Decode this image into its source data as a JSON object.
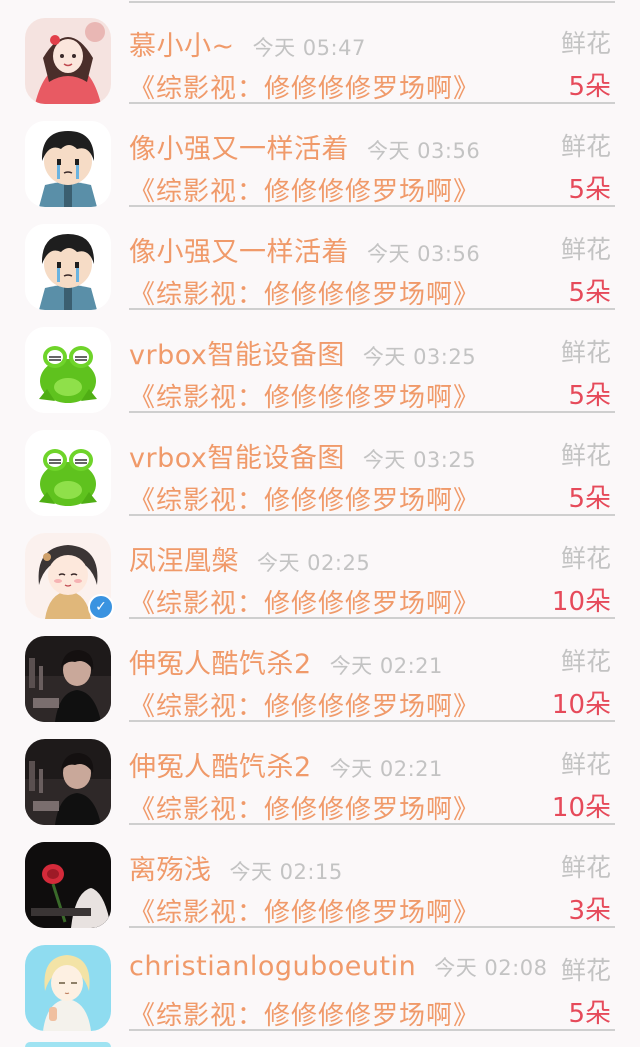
{
  "gift_label": "鲜花",
  "rows": [
    {
      "name": "慕小小~",
      "time": "今天 05:47",
      "book": "《综影视：修修修修罗场啊》",
      "count": "5朵",
      "avatar": "girl-red"
    },
    {
      "name": "像小强又一样活着",
      "time": "今天 03:56",
      "book": "《综影视：修修修修罗场啊》",
      "count": "5朵",
      "avatar": "crying-boy"
    },
    {
      "name": "像小强又一样活着",
      "time": "今天 03:56",
      "book": "《综影视：修修修修罗场啊》",
      "count": "5朵",
      "avatar": "crying-boy"
    },
    {
      "name": "vrbox智能设备图",
      "time": "今天 03:25",
      "book": "《综影视：修修修修罗场啊》",
      "count": "5朵",
      "avatar": "green-frog"
    },
    {
      "name": "vrbox智能设备图",
      "time": "今天 03:25",
      "book": "《综影视：修修修修罗场啊》",
      "count": "5朵",
      "avatar": "green-frog"
    },
    {
      "name": "凤涅凰槃",
      "time": "今天 02:25",
      "book": "《综影视：修修修修罗场啊》",
      "count": "10朵",
      "avatar": "chibi-girl",
      "verified": true
    },
    {
      "name": "伸冤人酷饩杀2",
      "time": "今天 02:21",
      "book": "《综影视：修修修修罗场啊》",
      "count": "10朵",
      "avatar": "dark-photo"
    },
    {
      "name": "伸冤人酷饩杀2",
      "time": "今天 02:21",
      "book": "《综影视：修修修修罗场啊》",
      "count": "10朵",
      "avatar": "dark-photo"
    },
    {
      "name": "离殇浅",
      "time": "今天 02:15",
      "book": "《综影视：修修修修罗场啊》",
      "count": "3朵",
      "avatar": "rose-photo"
    },
    {
      "name": "christianloguboeutin",
      "time": "今天 02:08",
      "book": "《综影视：修修修修罗场啊》",
      "count": "5朵",
      "avatar": "anime-blonde"
    }
  ],
  "colors": {
    "name": "#f09a6a",
    "time": "#c3c3c3",
    "count": "#e64a5a",
    "background": "#fbf8f9"
  }
}
